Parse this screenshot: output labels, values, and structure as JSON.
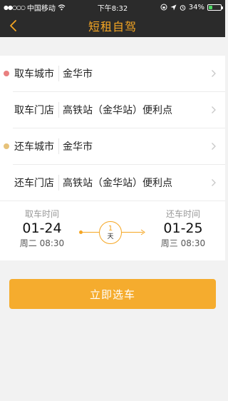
{
  "status_bar": {
    "carrier": "中国移动",
    "time": "下午8:32",
    "battery": "34%",
    "battery_level": 0.34
  },
  "nav": {
    "title": "短租自驾"
  },
  "form": {
    "pickup_city": {
      "label": "取车城市",
      "value": "金华市"
    },
    "pickup_store": {
      "label": "取车门店",
      "value": "高铁站（金华站）便利点"
    },
    "return_city": {
      "label": "还车城市",
      "value": "金华市"
    },
    "return_store": {
      "label": "还车门店",
      "value": "高铁站（金华站）便利点"
    }
  },
  "schedule": {
    "pickup": {
      "label": "取车时间",
      "date": "01-24",
      "sub": "周二 08:30"
    },
    "return": {
      "label": "还车时间",
      "date": "01-25",
      "sub": "周三 08:30"
    },
    "duration": {
      "count": "1",
      "unit": "天"
    }
  },
  "cta": {
    "label": "立即选车"
  },
  "colors": {
    "accent": "#f5a623",
    "header_bg": "#2b2b2b",
    "pickup_dot": "#e98080",
    "return_dot": "#e6c27a"
  }
}
